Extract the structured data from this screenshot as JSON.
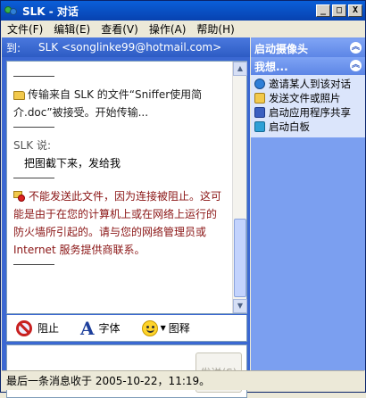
{
  "window": {
    "title": "SLK - 对话",
    "controls": {
      "minimize": "_",
      "maximize": "□",
      "close": "X"
    }
  },
  "menu": [
    "文件(F)",
    "编辑(E)",
    "查看(V)",
    "操作(A)",
    "帮助(H)"
  ],
  "to": {
    "label": "到:",
    "value": "SLK <songlinke99@hotmail.com>"
  },
  "history": {
    "file_msg": "传输来自 SLK 的文件“Sniffer使用简介.doc”被接受。开始传输...",
    "speaker": "SLK 说:",
    "message": "把图截下来，发给我",
    "error_msg": "不能发送此文件，因为连接被阻止。这可能是由于在您的计算机上或在网络上运行的防火墙所引起的。请与您的网络管理员或 Internet 服务提供商联系。"
  },
  "toolbar": {
    "block": "阻止",
    "font": "字体",
    "font_glyph": "A",
    "emoticons": "图释"
  },
  "compose": {
    "send": "发送(S)"
  },
  "sidebar": {
    "header_camera": "启动摄像头",
    "header_want": "我想...",
    "tasks": [
      {
        "label": "邀请某人到该对话",
        "icon": "invite-icon"
      },
      {
        "label": "发送文件或照片",
        "icon": "send-file-icon"
      },
      {
        "label": "启动应用程序共享",
        "icon": "app-share-icon"
      },
      {
        "label": "启动白板",
        "icon": "whiteboard-icon"
      }
    ]
  },
  "status": "最后一条消息收于 2005-10-22，11:19。",
  "colors": {
    "title_bar": "#0842b0",
    "to_bar": "#3b68d2",
    "sidebar": "#7b9ff0",
    "error_text": "#8a1414"
  }
}
